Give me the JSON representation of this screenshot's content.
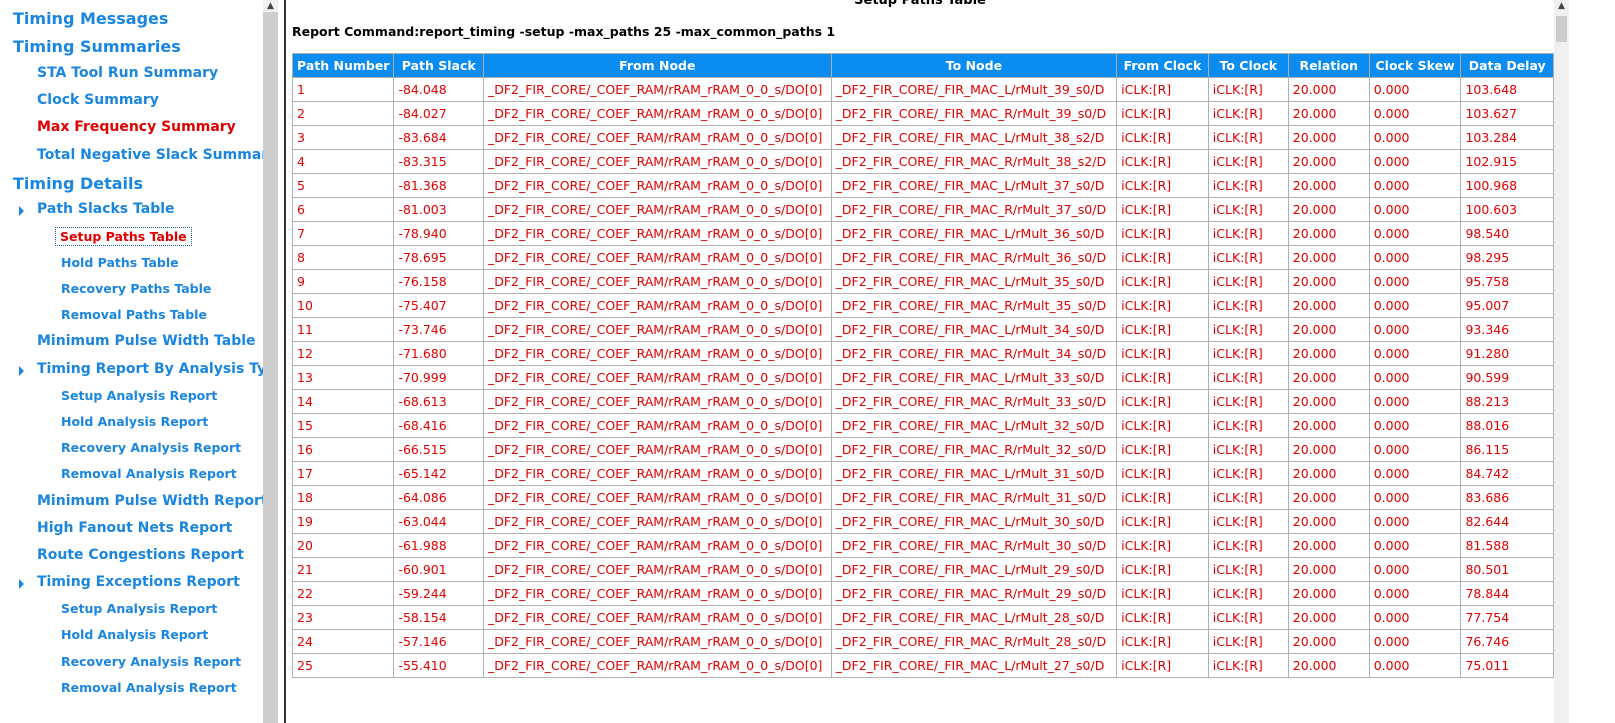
{
  "sidebar": {
    "items": [
      {
        "label": "Timing Messages",
        "level": 1
      },
      {
        "label": "Timing Summaries",
        "level": 1
      },
      {
        "label": "STA Tool Run Summary",
        "level": 2
      },
      {
        "label": "Clock Summary",
        "level": 2
      },
      {
        "label": "Max Frequency Summary",
        "level": 2,
        "state": "active"
      },
      {
        "label": "Total Negative Slack Summary",
        "level": 2
      },
      {
        "label": "Timing Details",
        "level": 1
      },
      {
        "label": "Path Slacks Table",
        "level": 2,
        "expand": true
      },
      {
        "label": "Setup Paths Table",
        "level": 3,
        "state": "selected"
      },
      {
        "label": "Hold Paths Table",
        "level": 3
      },
      {
        "label": "Recovery Paths Table",
        "level": 3
      },
      {
        "label": "Removal Paths Table",
        "level": 3
      },
      {
        "label": "Minimum Pulse Width Table",
        "level": 2
      },
      {
        "label": "Timing Report By Analysis Type",
        "level": 2,
        "expand": true
      },
      {
        "label": "Setup Analysis Report",
        "level": 3
      },
      {
        "label": "Hold Analysis Report",
        "level": 3
      },
      {
        "label": "Recovery Analysis Report",
        "level": 3
      },
      {
        "label": "Removal Analysis Report",
        "level": 3
      },
      {
        "label": "Minimum Pulse Width Report",
        "level": 2
      },
      {
        "label": "High Fanout Nets Report",
        "level": 2
      },
      {
        "label": "Route Congestions Report",
        "level": 2
      },
      {
        "label": "Timing Exceptions Report",
        "level": 2,
        "expand": true
      },
      {
        "label": "Setup Analysis Report",
        "level": 3
      },
      {
        "label": "Hold Analysis Report",
        "level": 3
      },
      {
        "label": "Recovery Analysis Report",
        "level": 3
      },
      {
        "label": "Removal Analysis Report",
        "level": 3
      }
    ]
  },
  "main": {
    "title": "Setup Paths Table",
    "command": "Report Command:report_timing -setup -max_paths 25 -max_common_paths 1",
    "columns": [
      "Path Number",
      "Path Slack",
      "From Node",
      "To Node",
      "From Clock",
      "To Clock",
      "Relation",
      "Clock Skew",
      "Data Delay"
    ],
    "rows": [
      [
        "1",
        "-84.048",
        "_DF2_FIR_CORE/_COEF_RAM/rRAM_rRAM_0_0_s/DO[0]",
        "_DF2_FIR_CORE/_FIR_MAC_L/rMult_39_s0/D",
        "iCLK:[R]",
        "iCLK:[R]",
        "20.000",
        "0.000",
        "103.648"
      ],
      [
        "2",
        "-84.027",
        "_DF2_FIR_CORE/_COEF_RAM/rRAM_rRAM_0_0_s/DO[0]",
        "_DF2_FIR_CORE/_FIR_MAC_R/rMult_39_s0/D",
        "iCLK:[R]",
        "iCLK:[R]",
        "20.000",
        "0.000",
        "103.627"
      ],
      [
        "3",
        "-83.684",
        "_DF2_FIR_CORE/_COEF_RAM/rRAM_rRAM_0_0_s/DO[0]",
        "_DF2_FIR_CORE/_FIR_MAC_L/rMult_38_s2/D",
        "iCLK:[R]",
        "iCLK:[R]",
        "20.000",
        "0.000",
        "103.284"
      ],
      [
        "4",
        "-83.315",
        "_DF2_FIR_CORE/_COEF_RAM/rRAM_rRAM_0_0_s/DO[0]",
        "_DF2_FIR_CORE/_FIR_MAC_R/rMult_38_s2/D",
        "iCLK:[R]",
        "iCLK:[R]",
        "20.000",
        "0.000",
        "102.915"
      ],
      [
        "5",
        "-81.368",
        "_DF2_FIR_CORE/_COEF_RAM/rRAM_rRAM_0_0_s/DO[0]",
        "_DF2_FIR_CORE/_FIR_MAC_L/rMult_37_s0/D",
        "iCLK:[R]",
        "iCLK:[R]",
        "20.000",
        "0.000",
        "100.968"
      ],
      [
        "6",
        "-81.003",
        "_DF2_FIR_CORE/_COEF_RAM/rRAM_rRAM_0_0_s/DO[0]",
        "_DF2_FIR_CORE/_FIR_MAC_R/rMult_37_s0/D",
        "iCLK:[R]",
        "iCLK:[R]",
        "20.000",
        "0.000",
        "100.603"
      ],
      [
        "7",
        "-78.940",
        "_DF2_FIR_CORE/_COEF_RAM/rRAM_rRAM_0_0_s/DO[0]",
        "_DF2_FIR_CORE/_FIR_MAC_L/rMult_36_s0/D",
        "iCLK:[R]",
        "iCLK:[R]",
        "20.000",
        "0.000",
        "98.540"
      ],
      [
        "8",
        "-78.695",
        "_DF2_FIR_CORE/_COEF_RAM/rRAM_rRAM_0_0_s/DO[0]",
        "_DF2_FIR_CORE/_FIR_MAC_R/rMult_36_s0/D",
        "iCLK:[R]",
        "iCLK:[R]",
        "20.000",
        "0.000",
        "98.295"
      ],
      [
        "9",
        "-76.158",
        "_DF2_FIR_CORE/_COEF_RAM/rRAM_rRAM_0_0_s/DO[0]",
        "_DF2_FIR_CORE/_FIR_MAC_L/rMult_35_s0/D",
        "iCLK:[R]",
        "iCLK:[R]",
        "20.000",
        "0.000",
        "95.758"
      ],
      [
        "10",
        "-75.407",
        "_DF2_FIR_CORE/_COEF_RAM/rRAM_rRAM_0_0_s/DO[0]",
        "_DF2_FIR_CORE/_FIR_MAC_R/rMult_35_s0/D",
        "iCLK:[R]",
        "iCLK:[R]",
        "20.000",
        "0.000",
        "95.007"
      ],
      [
        "11",
        "-73.746",
        "_DF2_FIR_CORE/_COEF_RAM/rRAM_rRAM_0_0_s/DO[0]",
        "_DF2_FIR_CORE/_FIR_MAC_L/rMult_34_s0/D",
        "iCLK:[R]",
        "iCLK:[R]",
        "20.000",
        "0.000",
        "93.346"
      ],
      [
        "12",
        "-71.680",
        "_DF2_FIR_CORE/_COEF_RAM/rRAM_rRAM_0_0_s/DO[0]",
        "_DF2_FIR_CORE/_FIR_MAC_R/rMult_34_s0/D",
        "iCLK:[R]",
        "iCLK:[R]",
        "20.000",
        "0.000",
        "91.280"
      ],
      [
        "13",
        "-70.999",
        "_DF2_FIR_CORE/_COEF_RAM/rRAM_rRAM_0_0_s/DO[0]",
        "_DF2_FIR_CORE/_FIR_MAC_L/rMult_33_s0/D",
        "iCLK:[R]",
        "iCLK:[R]",
        "20.000",
        "0.000",
        "90.599"
      ],
      [
        "14",
        "-68.613",
        "_DF2_FIR_CORE/_COEF_RAM/rRAM_rRAM_0_0_s/DO[0]",
        "_DF2_FIR_CORE/_FIR_MAC_R/rMult_33_s0/D",
        "iCLK:[R]",
        "iCLK:[R]",
        "20.000",
        "0.000",
        "88.213"
      ],
      [
        "15",
        "-68.416",
        "_DF2_FIR_CORE/_COEF_RAM/rRAM_rRAM_0_0_s/DO[0]",
        "_DF2_FIR_CORE/_FIR_MAC_L/rMult_32_s0/D",
        "iCLK:[R]",
        "iCLK:[R]",
        "20.000",
        "0.000",
        "88.016"
      ],
      [
        "16",
        "-66.515",
        "_DF2_FIR_CORE/_COEF_RAM/rRAM_rRAM_0_0_s/DO[0]",
        "_DF2_FIR_CORE/_FIR_MAC_R/rMult_32_s0/D",
        "iCLK:[R]",
        "iCLK:[R]",
        "20.000",
        "0.000",
        "86.115"
      ],
      [
        "17",
        "-65.142",
        "_DF2_FIR_CORE/_COEF_RAM/rRAM_rRAM_0_0_s/DO[0]",
        "_DF2_FIR_CORE/_FIR_MAC_L/rMult_31_s0/D",
        "iCLK:[R]",
        "iCLK:[R]",
        "20.000",
        "0.000",
        "84.742"
      ],
      [
        "18",
        "-64.086",
        "_DF2_FIR_CORE/_COEF_RAM/rRAM_rRAM_0_0_s/DO[0]",
        "_DF2_FIR_CORE/_FIR_MAC_R/rMult_31_s0/D",
        "iCLK:[R]",
        "iCLK:[R]",
        "20.000",
        "0.000",
        "83.686"
      ],
      [
        "19",
        "-63.044",
        "_DF2_FIR_CORE/_COEF_RAM/rRAM_rRAM_0_0_s/DO[0]",
        "_DF2_FIR_CORE/_FIR_MAC_L/rMult_30_s0/D",
        "iCLK:[R]",
        "iCLK:[R]",
        "20.000",
        "0.000",
        "82.644"
      ],
      [
        "20",
        "-61.988",
        "_DF2_FIR_CORE/_COEF_RAM/rRAM_rRAM_0_0_s/DO[0]",
        "_DF2_FIR_CORE/_FIR_MAC_R/rMult_30_s0/D",
        "iCLK:[R]",
        "iCLK:[R]",
        "20.000",
        "0.000",
        "81.588"
      ],
      [
        "21",
        "-60.901",
        "_DF2_FIR_CORE/_COEF_RAM/rRAM_rRAM_0_0_s/DO[0]",
        "_DF2_FIR_CORE/_FIR_MAC_L/rMult_29_s0/D",
        "iCLK:[R]",
        "iCLK:[R]",
        "20.000",
        "0.000",
        "80.501"
      ],
      [
        "22",
        "-59.244",
        "_DF2_FIR_CORE/_COEF_RAM/rRAM_rRAM_0_0_s/DO[0]",
        "_DF2_FIR_CORE/_FIR_MAC_R/rMult_29_s0/D",
        "iCLK:[R]",
        "iCLK:[R]",
        "20.000",
        "0.000",
        "78.844"
      ],
      [
        "23",
        "-58.154",
        "_DF2_FIR_CORE/_COEF_RAM/rRAM_rRAM_0_0_s/DO[0]",
        "_DF2_FIR_CORE/_FIR_MAC_L/rMult_28_s0/D",
        "iCLK:[R]",
        "iCLK:[R]",
        "20.000",
        "0.000",
        "77.754"
      ],
      [
        "24",
        "-57.146",
        "_DF2_FIR_CORE/_COEF_RAM/rRAM_rRAM_0_0_s/DO[0]",
        "_DF2_FIR_CORE/_FIR_MAC_R/rMult_28_s0/D",
        "iCLK:[R]",
        "iCLK:[R]",
        "20.000",
        "0.000",
        "76.746"
      ],
      [
        "25",
        "-55.410",
        "_DF2_FIR_CORE/_COEF_RAM/rRAM_rRAM_0_0_s/DO[0]",
        "_DF2_FIR_CORE/_FIR_MAC_L/rMult_27_s0/D",
        "iCLK:[R]",
        "iCLK:[R]",
        "20.000",
        "0.000",
        "75.011"
      ]
    ]
  },
  "colors": {
    "link": "#1a86e0",
    "active": "#e00000",
    "header_bg": "#0a8cf0"
  }
}
